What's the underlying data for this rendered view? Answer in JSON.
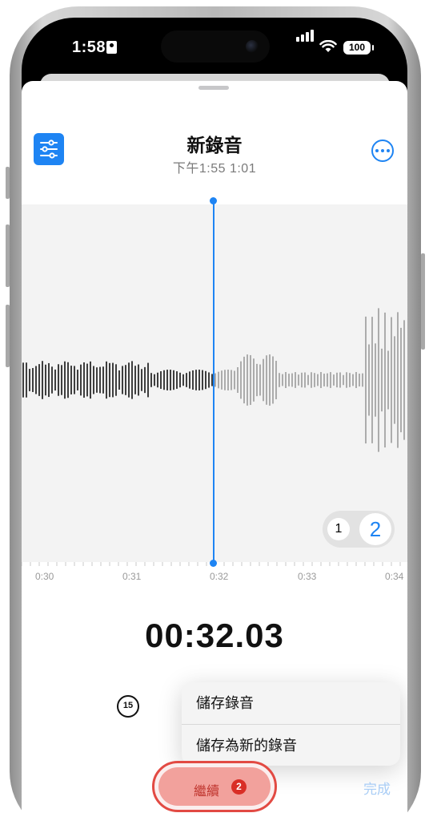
{
  "status_bar": {
    "time": "1:58",
    "battery": "100"
  },
  "header": {
    "title": "新錄音",
    "subtitle": "下午1:55  1:01"
  },
  "timeline": {
    "ticks": [
      "0:30",
      "0:31",
      "0:32",
      "0:33",
      "0:34"
    ]
  },
  "playback_speed": {
    "option_1": "1",
    "option_2": "2",
    "selected": "2"
  },
  "timer": "00:32.03",
  "skip_back": "15",
  "menu": {
    "items": [
      "儲存錄音",
      "儲存為新的錄音"
    ]
  },
  "resume_button": {
    "label": "繼續",
    "badge": "2"
  },
  "done_button": "完成",
  "colors": {
    "accent": "#1e84f3",
    "record_red": "#e24a43",
    "done_disabled": "#a9cdf6"
  },
  "icons": {
    "filter": "sliders-icon",
    "more": "ellipsis-circle-icon",
    "skip": "rewind-15-icon"
  }
}
